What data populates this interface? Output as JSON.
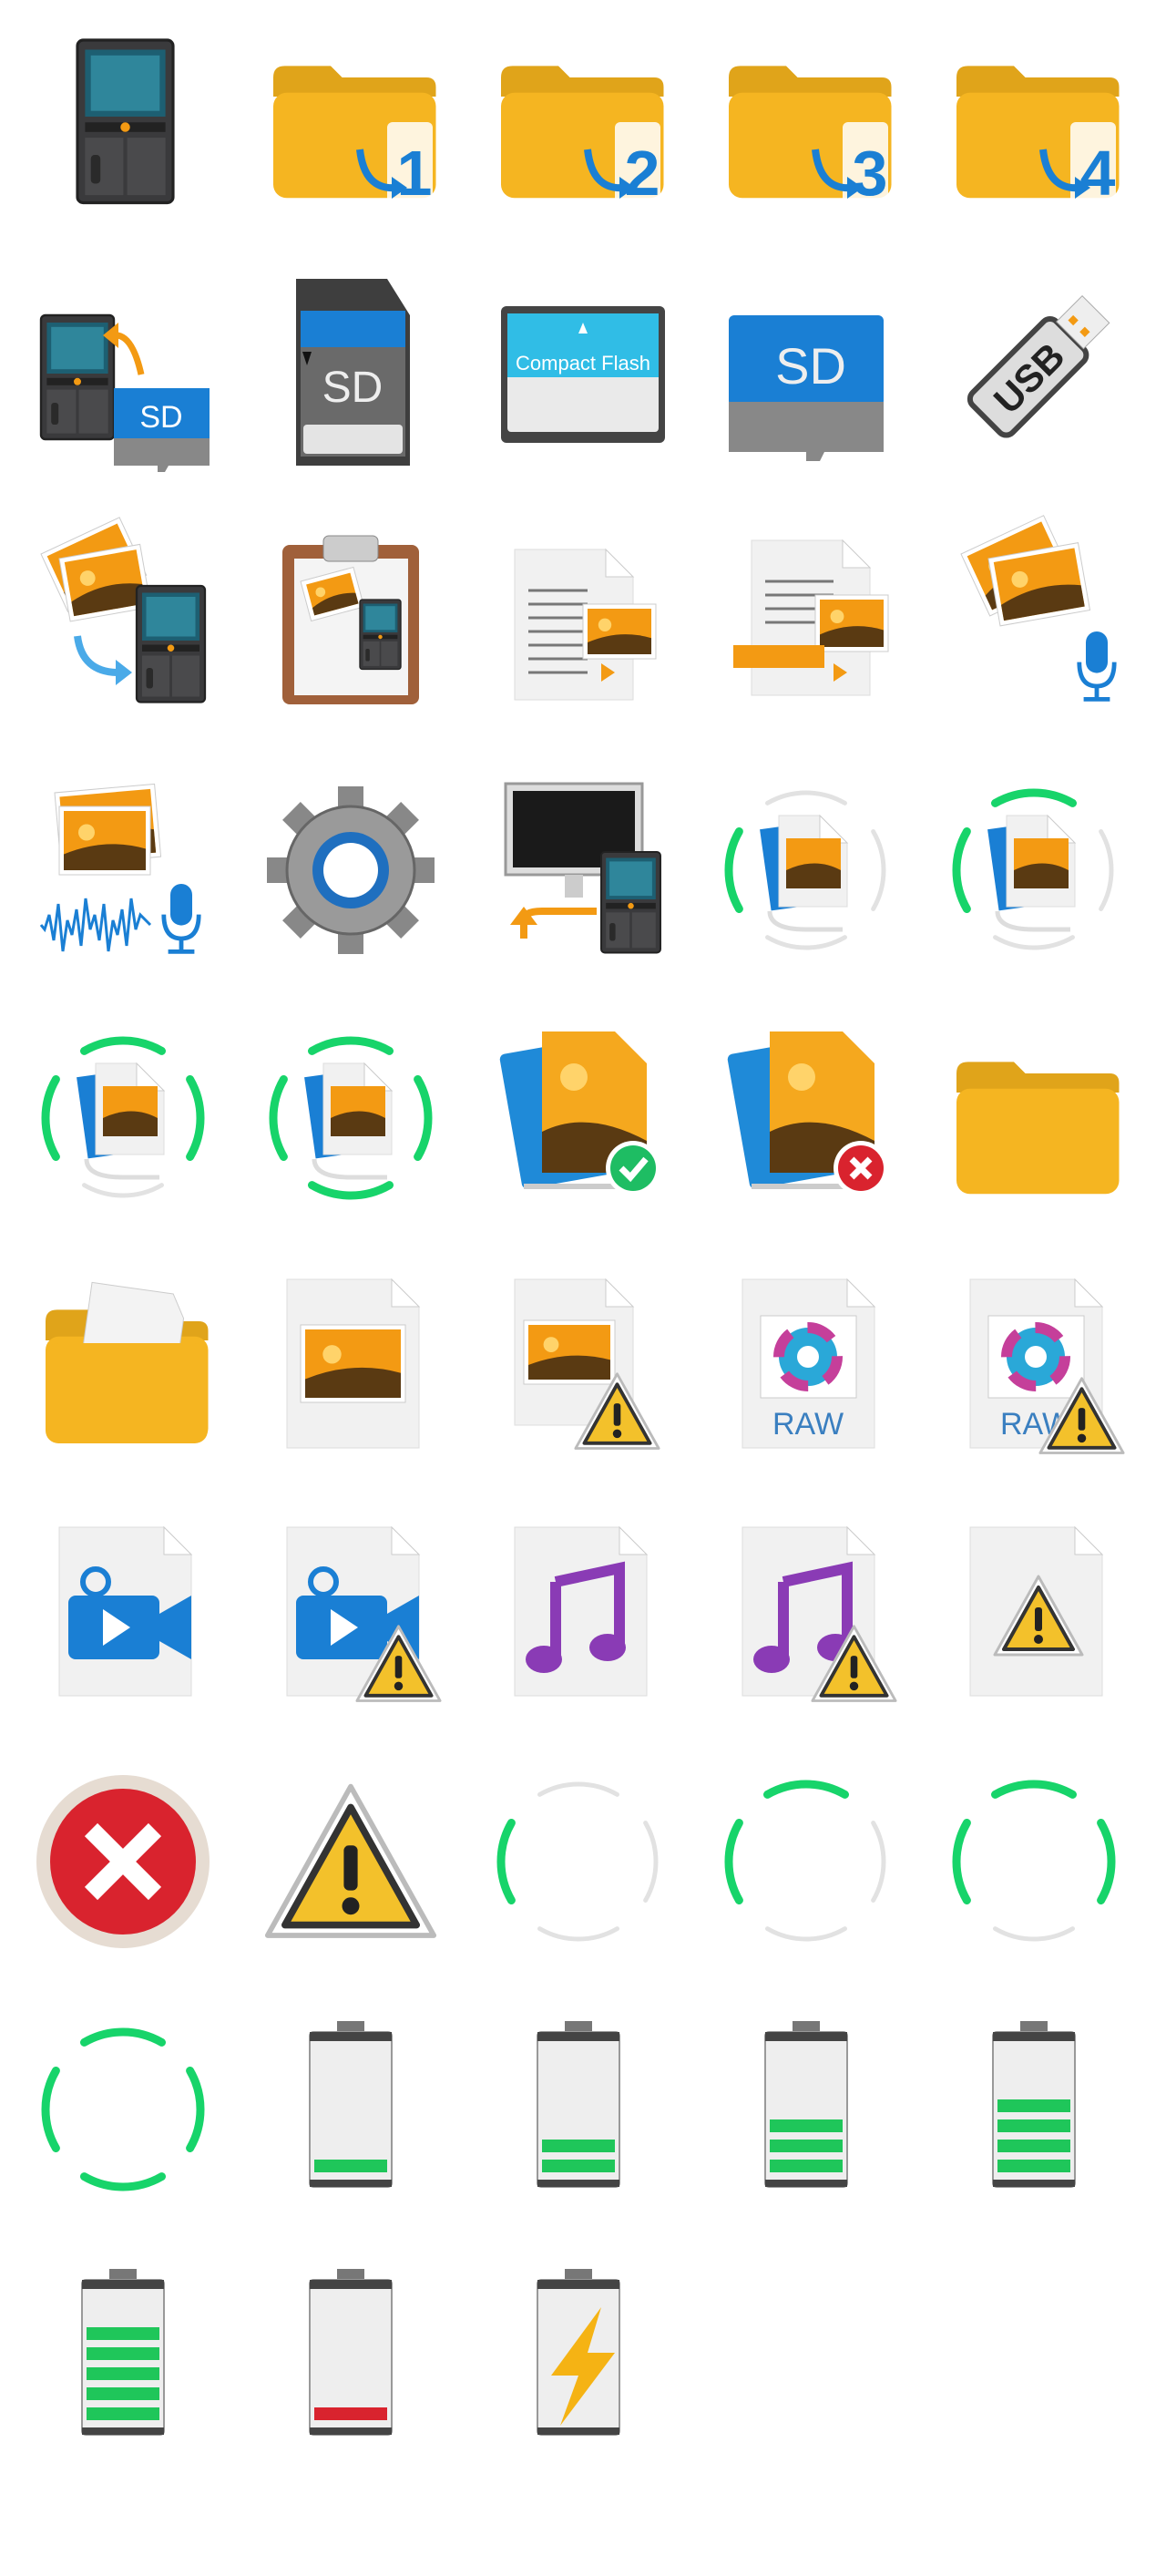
{
  "colors": {
    "folder": "#f5b521",
    "blue": "#1a7fd4",
    "green": "#17d46a",
    "red": "#d9232e",
    "warning": "#f3c12b",
    "purple": "#8a3bb5",
    "orange": "#f39a13"
  },
  "icons": [
    {
      "icon": "recorder-icon"
    },
    {
      "icon": "folder-numbered-icon",
      "text": "1"
    },
    {
      "icon": "folder-numbered-icon",
      "text": "2"
    },
    {
      "icon": "folder-numbered-icon",
      "text": "3"
    },
    {
      "icon": "folder-numbered-icon",
      "text": "4"
    },
    {
      "icon": "recorder-to-microsd-icon",
      "text": "SD"
    },
    {
      "icon": "sd-card-icon",
      "text": "SD"
    },
    {
      "icon": "compact-flash-icon",
      "text": "Compact Flash"
    },
    {
      "icon": "microsd-card-icon",
      "text": "SD"
    },
    {
      "icon": "usb-drive-icon",
      "text": "USB"
    },
    {
      "icon": "image-to-recorder-icon"
    },
    {
      "icon": "clipboard-image-recorder-icon"
    },
    {
      "icon": "document-image-icon"
    },
    {
      "icon": "document-image-banner-icon"
    },
    {
      "icon": "image-microphone-icon"
    },
    {
      "icon": "image-waveform-microphone-icon"
    },
    {
      "icon": "gear-icon"
    },
    {
      "icon": "monitor-to-recorder-icon"
    },
    {
      "icon": "sync-image-icon",
      "segments": [
        "left"
      ]
    },
    {
      "icon": "sync-image-icon",
      "segments": [
        "left",
        "top"
      ]
    },
    {
      "icon": "sync-image-icon",
      "segments": [
        "left",
        "top",
        "right"
      ]
    },
    {
      "icon": "sync-image-icon",
      "segments": [
        "left",
        "top",
        "right",
        "bottom"
      ]
    },
    {
      "icon": "images-success-icon"
    },
    {
      "icon": "images-failed-icon"
    },
    {
      "icon": "folder-icon"
    },
    {
      "icon": "folder-open-icon"
    },
    {
      "icon": "file-image-icon"
    },
    {
      "icon": "file-image-warning-icon"
    },
    {
      "icon": "file-raw-icon",
      "text": "RAW"
    },
    {
      "icon": "file-raw-warning-icon",
      "text": "RAW"
    },
    {
      "icon": "file-video-icon"
    },
    {
      "icon": "file-video-warning-icon"
    },
    {
      "icon": "file-music-icon"
    },
    {
      "icon": "file-music-warning-icon"
    },
    {
      "icon": "file-warning-icon"
    },
    {
      "icon": "error-circle-icon"
    },
    {
      "icon": "warning-triangle-icon"
    },
    {
      "icon": "progress-ring-icon",
      "segments": [
        "left"
      ]
    },
    {
      "icon": "progress-ring-icon",
      "segments": [
        "left",
        "top"
      ]
    },
    {
      "icon": "progress-ring-icon",
      "segments": [
        "left",
        "top",
        "right"
      ]
    },
    {
      "icon": "progress-ring-icon",
      "segments": [
        "left",
        "top",
        "right",
        "bottom"
      ]
    },
    {
      "icon": "battery-icon",
      "level": 1
    },
    {
      "icon": "battery-icon",
      "level": 2
    },
    {
      "icon": "battery-icon",
      "level": 3
    },
    {
      "icon": "battery-icon",
      "level": 4
    },
    {
      "icon": "battery-icon",
      "level": 5
    },
    {
      "icon": "battery-low-icon",
      "level": 1
    },
    {
      "icon": "battery-charging-icon"
    }
  ]
}
